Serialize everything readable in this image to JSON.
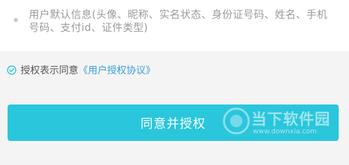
{
  "info": {
    "items": [
      {
        "text": "用户默认信息(头像、昵称、实名状态、身份证号码、姓名、手机号码、支付id、证件类型)"
      }
    ]
  },
  "agreement": {
    "prefix": "授权表示同意",
    "link": "《用户授权协议》",
    "icon": "check-circle-icon"
  },
  "button": {
    "label": "同意并授权"
  },
  "watermark": {
    "brand": "当下软件园",
    "url": "www.downxia.com"
  },
  "colors": {
    "button": "#2ac6dc",
    "link": "#3aa0e0",
    "check": "#2ac6dc"
  }
}
